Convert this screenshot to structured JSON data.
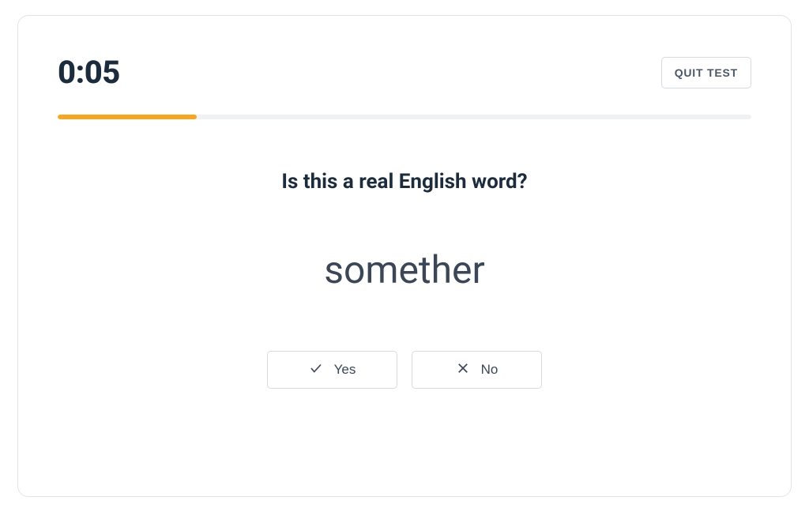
{
  "header": {
    "timer": "0:05",
    "quit_label": "QUIT TEST"
  },
  "progress": {
    "percent": 20,
    "track_color": "#f0f1f3",
    "fill_color": "#f5a623"
  },
  "question": "Is this a real English word?",
  "word": "somether",
  "buttons": {
    "yes_label": "Yes",
    "no_label": "No"
  }
}
